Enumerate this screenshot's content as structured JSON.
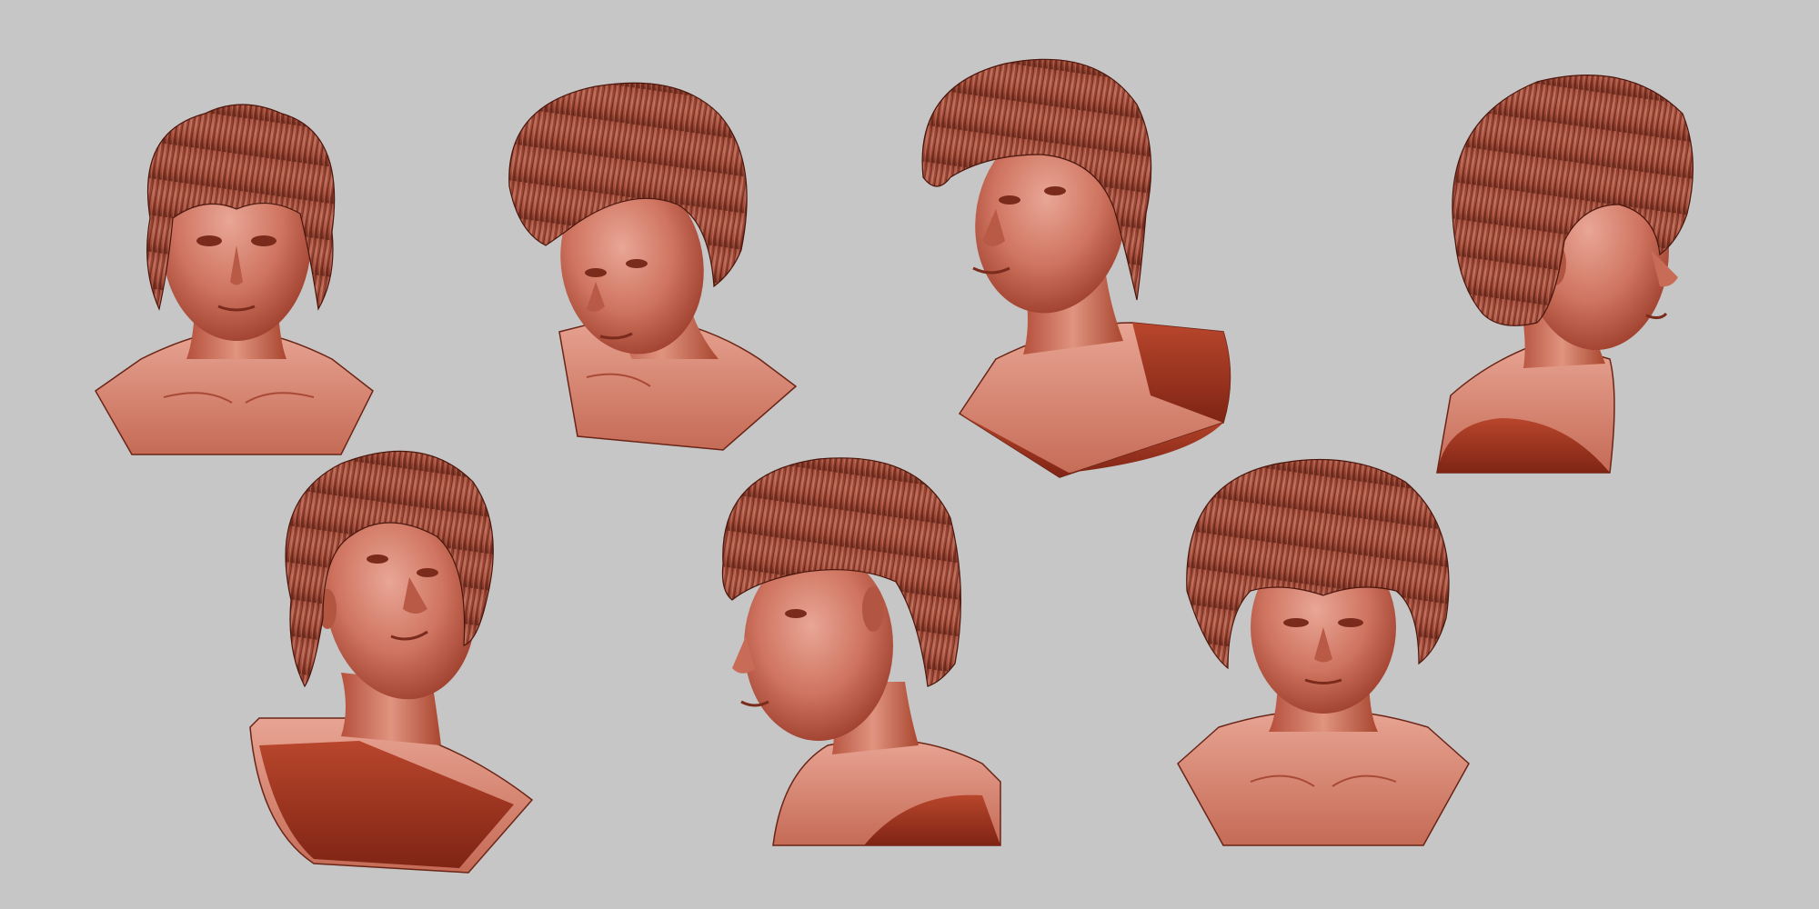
{
  "scene": {
    "background_color": "#c6c6c6",
    "material_color": "#c0604c",
    "material_shadow": "#8a2e1e",
    "material_highlight": "#e8a090",
    "hair_color": "#a0483a",
    "base_dark": "#a83a22"
  },
  "views": [
    {
      "name": "front",
      "angle": "front"
    },
    {
      "name": "three-quarter-down-left",
      "angle": "down-left"
    },
    {
      "name": "three-quarter-up-left",
      "angle": "up-left"
    },
    {
      "name": "right-profile",
      "angle": "right"
    },
    {
      "name": "three-quarter-up-right",
      "angle": "up-right"
    },
    {
      "name": "left-profile",
      "angle": "left"
    },
    {
      "name": "front-down",
      "angle": "down-front"
    }
  ]
}
